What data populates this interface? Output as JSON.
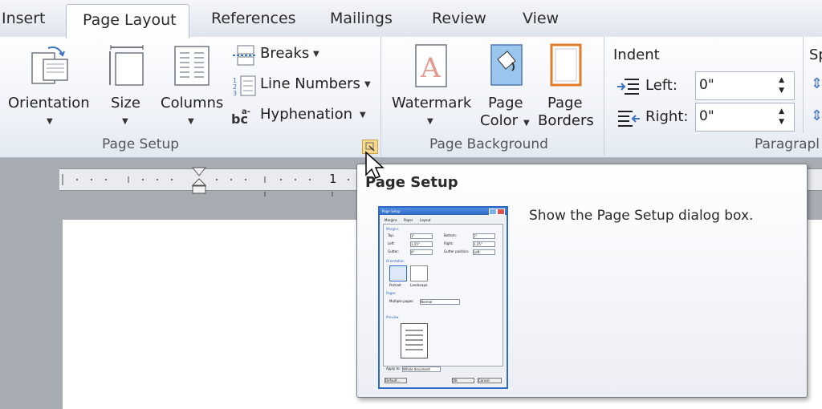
{
  "tabs": {
    "insert": "Insert",
    "page_layout": "Page Layout",
    "references": "References",
    "mailings": "Mailings",
    "review": "Review",
    "view": "View"
  },
  "page_setup": {
    "orientation": "Orientation",
    "size": "Size",
    "columns": "Columns",
    "breaks": "Breaks",
    "line_numbers": "Line Numbers",
    "hyphenation": "Hyphenation",
    "group_label": "Page Setup"
  },
  "page_background": {
    "watermark": "Watermark",
    "page_color_1": "Page",
    "page_color_2": "Color",
    "page_borders_1": "Page",
    "page_borders_2": "Borders",
    "group_label": "Page Background"
  },
  "paragraph": {
    "indent_heading": "Indent",
    "left_label": "Left:",
    "left_value": "0\"",
    "right_label": "Right:",
    "right_value": "0\"",
    "spacing_heading_partial": "Sp",
    "group_label_partial": "Paragrapl"
  },
  "ruler": {
    "mark_1": "1"
  },
  "tooltip": {
    "title": "Page Setup",
    "description": "Show the Page Setup dialog box."
  },
  "mini_dialog": {
    "title": "Page Setup",
    "tabs": [
      "Margins",
      "Paper",
      "Layout"
    ],
    "sections": [
      "Margins",
      "Orientation",
      "Pages",
      "Preview"
    ],
    "margin_fields": [
      "Top:",
      "Bottom:",
      "Left:",
      "Right:",
      "Gutter:",
      "Gutter position:"
    ],
    "margin_values": [
      "1\"",
      "1\"",
      "1.25\"",
      "1.25\"",
      "0\"",
      "Left"
    ],
    "orientation_options": [
      "Portrait",
      "Landscape"
    ],
    "multiple_pages_label": "Multiple pages:",
    "multiple_pages_value": "Normal",
    "apply_to_label": "Apply to:",
    "apply_to_value": "Whole document",
    "default_button": "Default...",
    "ok_button": "OK",
    "cancel_button": "Cancel"
  },
  "colors": {
    "accent_blue": "#2f6ac7",
    "dialog_launcher_highlight": "#f7d98b"
  }
}
